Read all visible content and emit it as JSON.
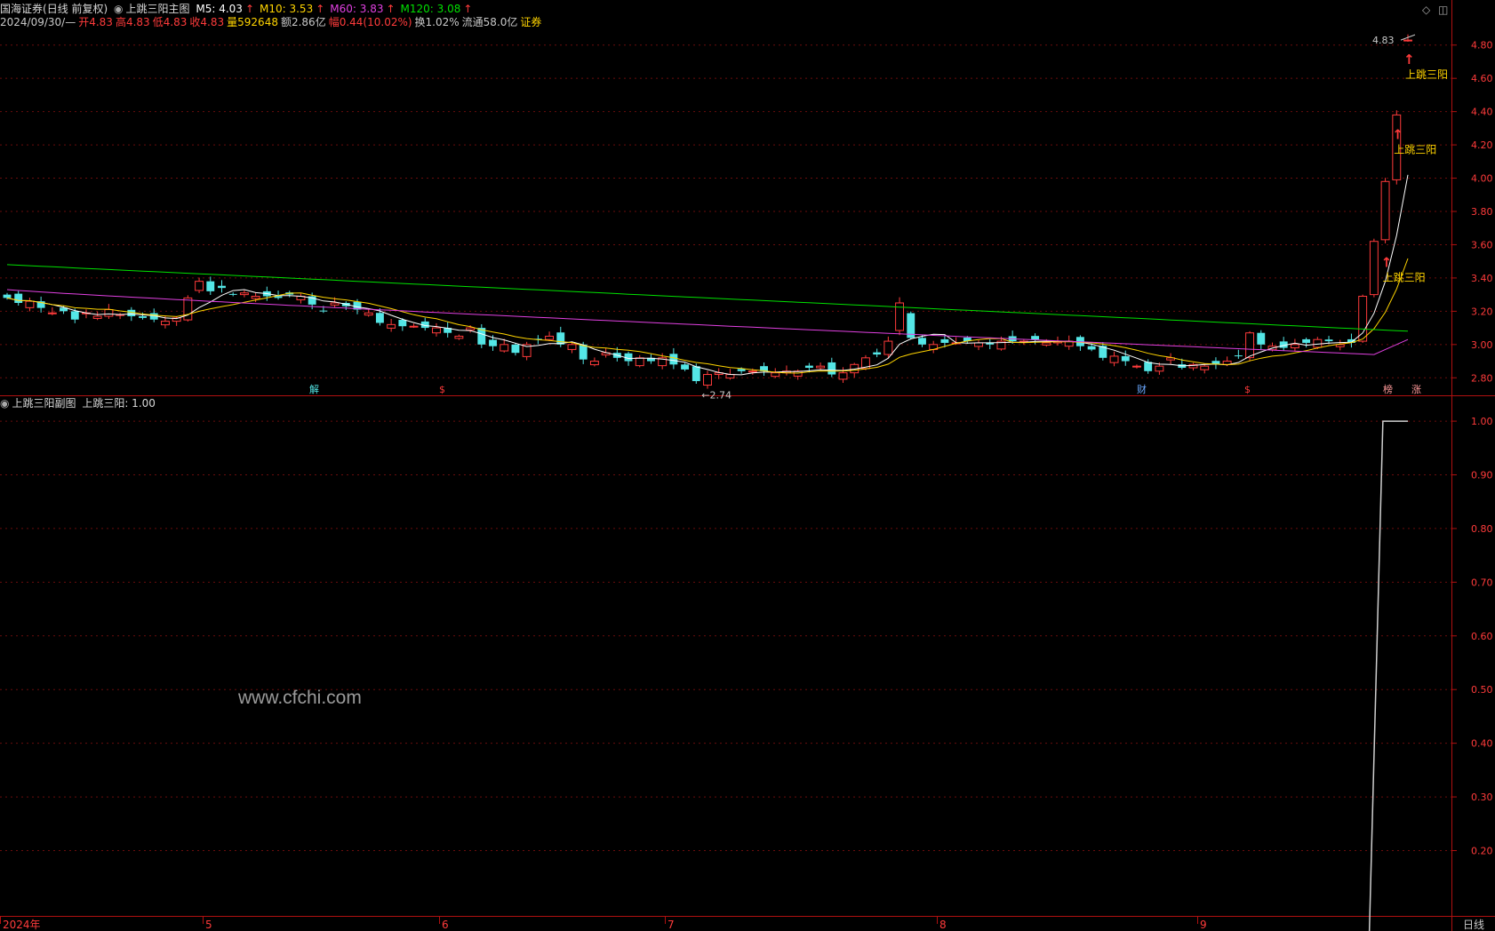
{
  "header": {
    "broker": "国海证券",
    "mode": "(日线 前复权)",
    "main_indicator": "上跳三阳主图",
    "ma": [
      {
        "label": "M5: 4.03",
        "color": "#ffffff"
      },
      {
        "label": "M10: 3.53",
        "color": "#ffd400"
      },
      {
        "label": "M60: 3.83",
        "color": "#e040e0"
      },
      {
        "label": "M120: 3.08",
        "color": "#00e000"
      }
    ],
    "ma_arrow": "↑",
    "info": [
      {
        "label": "2024/09/30/—",
        "color": "#c8c8c8"
      },
      {
        "label": "开4.83",
        "color": "#ff3b3b"
      },
      {
        "label": "高4.83",
        "color": "#ff3b3b"
      },
      {
        "label": "低4.83",
        "color": "#ff3b3b"
      },
      {
        "label": "收4.83",
        "color": "#ff3b3b"
      },
      {
        "label": "量592648",
        "color": "#ffd400"
      },
      {
        "label": "额2.86亿",
        "color": "#c8c8c8"
      },
      {
        "label": "幅0.44(10.02%)",
        "color": "#ff3b3b"
      },
      {
        "label": "换1.02%",
        "color": "#c8c8c8"
      },
      {
        "label": "流通58.0亿",
        "color": "#c8c8c8"
      },
      {
        "label": "证券",
        "color": "#ffd400"
      }
    ],
    "sub_indicator": "上跳三阳副图",
    "sub_value": "上跳三阳: 1.00"
  },
  "watermark": "www.cfchi.com",
  "chart_data": [
    {
      "type": "candlestick",
      "title": "上跳三阳主图",
      "ylim": [
        2.7,
        4.9
      ],
      "y_ticks": [
        2.8,
        3.0,
        3.2,
        3.4,
        3.6,
        3.8,
        4.0,
        4.2,
        4.4,
        4.6,
        4.8
      ],
      "y_tick_labels": [
        "2.80",
        "3.00",
        "3.20",
        "3.40",
        "3.60",
        "3.80",
        "4.00",
        "4.20",
        "4.40",
        "4.60",
        "4.80"
      ],
      "grid": true,
      "bar_count": 125,
      "closes": [
        3.28,
        3.25,
        3.26,
        3.22,
        3.19,
        3.2,
        3.15,
        3.19,
        3.17,
        3.21,
        3.18,
        3.17,
        3.16,
        3.15,
        3.14,
        3.16,
        3.28,
        3.38,
        3.32,
        3.34,
        3.3,
        3.31,
        3.29,
        3.29,
        3.28,
        3.3,
        3.29,
        3.24,
        3.2,
        3.25,
        3.23,
        3.21,
        3.19,
        3.13,
        3.12,
        3.11,
        3.11,
        3.1,
        3.1,
        3.07,
        3.05,
        3.1,
        3.0,
        2.99,
        3.0,
        2.95,
        3.0,
        3.03,
        3.05,
        3.0,
        3.0,
        2.91,
        2.9,
        2.95,
        2.92,
        2.9,
        2.92,
        2.9,
        2.92,
        2.88,
        2.85,
        2.78,
        2.82,
        2.83,
        2.82,
        2.84,
        2.84,
        2.84,
        2.83,
        2.84,
        2.84,
        2.86,
        2.87,
        2.82,
        2.83,
        2.88,
        2.92,
        2.94,
        3.02,
        3.25,
        3.04,
        3.0,
        3.0,
        3.01,
        3.01,
        3.02,
        3.01,
        3.0,
        3.02,
        3.02,
        3.02,
        3.03,
        3.01,
        3.02,
        3.02,
        2.99,
        2.97,
        2.92,
        2.93,
        2.9,
        2.87,
        2.84,
        2.87,
        2.92,
        2.86,
        2.88,
        2.87,
        2.88,
        2.9,
        2.93,
        3.07,
        3.0,
        2.99,
        2.98,
        3.0,
        3.01,
        3.03,
        3.02,
        3.0,
        3.01,
        3.29,
        3.62,
        3.98,
        4.38,
        4.83
      ],
      "labels": [
        {
          "text": "←2.74",
          "value": 2.74
        },
        {
          "text": "4.83",
          "value": 4.83
        },
        {
          "text": "上跳三阳"
        },
        {
          "text": "上跳三阳"
        },
        {
          "text": "上跳三阳"
        }
      ],
      "event_markers": [
        "解",
        "$",
        "财",
        "$",
        "榜",
        "涨"
      ],
      "series": [
        {
          "name": "M5",
          "color": "#ffffff"
        },
        {
          "name": "M10",
          "color": "#ffd400"
        },
        {
          "name": "M60",
          "color": "#e040e0"
        },
        {
          "name": "M120",
          "color": "#00e000"
        }
      ]
    },
    {
      "type": "line",
      "title": "上跳三阳副图",
      "ylim": [
        0.08,
        1.02
      ],
      "y_ticks": [
        0.2,
        0.3,
        0.4,
        0.5,
        0.6,
        0.7,
        0.8,
        0.9,
        1.0
      ],
      "y_tick_labels": [
        "0.20",
        "0.30",
        "0.40",
        "0.50",
        "0.60",
        "0.70",
        "0.80",
        "0.90",
        "1.00"
      ],
      "series": [
        {
          "name": "上跳三阳",
          "color": "#cfcfcf",
          "step_index": 122,
          "low": 0.0,
          "high": 1.0
        }
      ]
    }
  ],
  "x_axis": {
    "labels": [
      "2024年",
      "5",
      "6",
      "7",
      "8",
      "9"
    ],
    "right_label": "日线"
  }
}
